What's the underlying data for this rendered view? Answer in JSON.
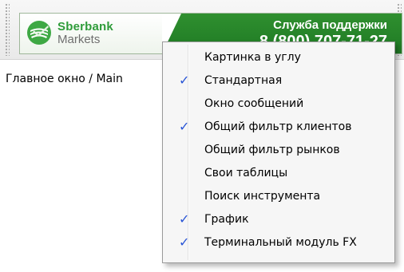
{
  "banner": {
    "logo_title": "Sberbank",
    "logo_subtitle": "Markets",
    "support_label": "Служба поддержки",
    "support_phone": "8 (800) 707-71-27",
    "colors": {
      "brand_green": "#2f9c3a",
      "banner_green": "#1f7a24"
    }
  },
  "main": {
    "title": "Главное окно / Main"
  },
  "context_menu": {
    "check_glyph": "✓",
    "check_color": "#2a56d6",
    "items": [
      {
        "label": "Картинка в углу",
        "checked": false
      },
      {
        "label": "Стандартная",
        "checked": true
      },
      {
        "label": "Окно сообщений",
        "checked": false
      },
      {
        "label": "Общий фильтр клиентов",
        "checked": true
      },
      {
        "label": "Общий фильтр рынков",
        "checked": false
      },
      {
        "label": "Свои таблицы",
        "checked": false
      },
      {
        "label": "Поиск инструмента",
        "checked": false
      },
      {
        "label": "График",
        "checked": true
      },
      {
        "label": "Терминальный модуль FX",
        "checked": true
      }
    ]
  }
}
